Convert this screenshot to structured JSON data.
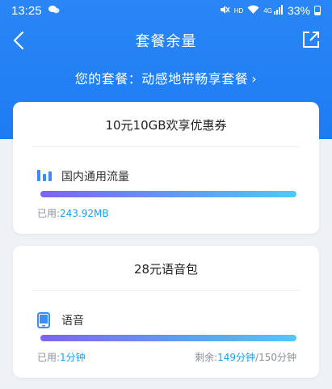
{
  "status_bar": {
    "time": "13:25",
    "battery": "33%",
    "network_label": "HD",
    "signal_label": "4G"
  },
  "nav": {
    "title": "套餐余量"
  },
  "plan": {
    "text": "您的套餐：动感地带畅享套餐",
    "chevron": "›"
  },
  "cards": [
    {
      "title": "10元10GB欢享优惠券",
      "item_label": "国内通用流量",
      "used_prefix": "已用:",
      "used_value": "243.92MB"
    },
    {
      "title": "28元语音包",
      "item_label": "语音",
      "used_prefix": "已用:",
      "used_value": "1分钟",
      "remain_prefix": "剩余:",
      "remain_value": "149分钟",
      "total_suffix": "/150分钟"
    }
  ],
  "colors": {
    "header_blue": "#2a86f6",
    "accent_blue": "#1e9ce8",
    "bar_start": "#7e63f2",
    "bar_end": "#4fc9f5"
  },
  "icons": {
    "back": "chevron-left-icon",
    "share": "external-link-icon",
    "data": "bar-chart-icon",
    "voice": "phone-icon"
  }
}
